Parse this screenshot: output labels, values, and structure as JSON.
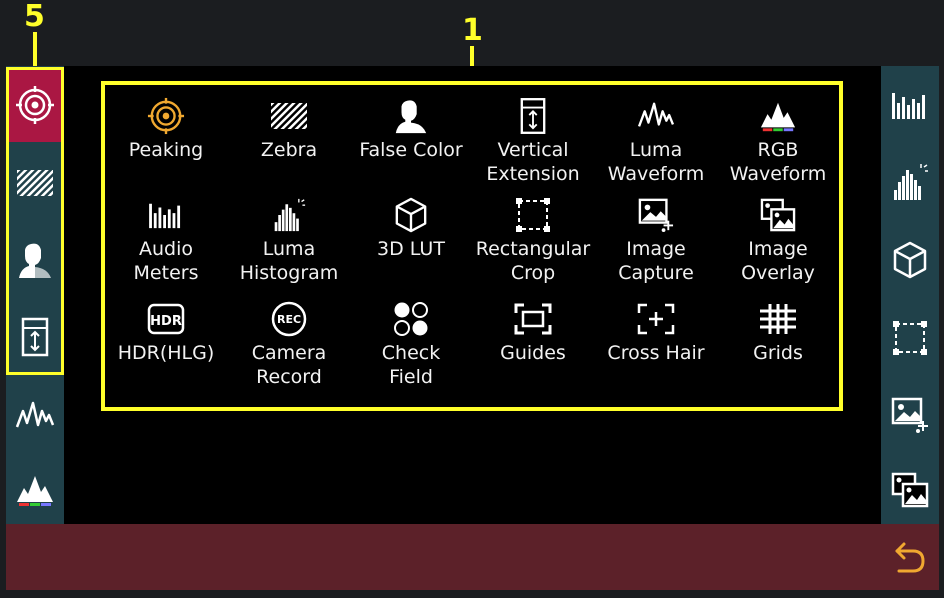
{
  "callouts": {
    "left_number": "5",
    "top_number": "1"
  },
  "colors": {
    "accent": "#ffff2a",
    "active": "#aa1743",
    "sidebar": "#20414a",
    "bottom": "#5c2129",
    "peaking": "#f0a830",
    "return": "#f0a830"
  },
  "left_sidebar": {
    "items": [
      {
        "icon": "peaking-icon",
        "active": true
      },
      {
        "icon": "zebra-icon",
        "active": false
      },
      {
        "icon": "false-color-icon",
        "active": false
      },
      {
        "icon": "vertical-extension-icon",
        "active": false
      },
      {
        "icon": "luma-waveform-icon",
        "active": false
      },
      {
        "icon": "rgb-waveform-icon",
        "active": false
      }
    ]
  },
  "right_sidebar": {
    "items": [
      {
        "icon": "audio-meters-icon"
      },
      {
        "icon": "luma-histogram-icon"
      },
      {
        "icon": "3d-lut-icon"
      },
      {
        "icon": "rectangular-crop-icon"
      },
      {
        "icon": "image-capture-icon"
      },
      {
        "icon": "image-overlay-icon"
      }
    ]
  },
  "tools": [
    {
      "label": "Peaking",
      "icon": "peaking-icon"
    },
    {
      "label": "Zebra",
      "icon": "zebra-icon"
    },
    {
      "label": "False Color",
      "icon": "false-color-icon"
    },
    {
      "label": "Vertical\nExtension",
      "icon": "vertical-extension-icon"
    },
    {
      "label": "Luma\nWaveform",
      "icon": "luma-waveform-icon"
    },
    {
      "label": "RGB\nWaveform",
      "icon": "rgb-waveform-icon"
    },
    {
      "label": "Audio\nMeters",
      "icon": "audio-meters-icon"
    },
    {
      "label": "Luma\nHistogram",
      "icon": "luma-histogram-icon"
    },
    {
      "label": "3D LUT",
      "icon": "3d-lut-icon"
    },
    {
      "label": "Rectangular\nCrop",
      "icon": "rectangular-crop-icon"
    },
    {
      "label": "Image\nCapture",
      "icon": "image-capture-icon"
    },
    {
      "label": "Image\nOverlay",
      "icon": "image-overlay-icon"
    },
    {
      "label": "HDR(HLG)",
      "icon": "hdr-icon",
      "icon_text": "HDR"
    },
    {
      "label": "Camera\nRecord",
      "icon": "camera-record-icon",
      "icon_text": "REC"
    },
    {
      "label": "Check\nField",
      "icon": "check-field-icon"
    },
    {
      "label": "Guides",
      "icon": "guides-icon"
    },
    {
      "label": "Cross Hair",
      "icon": "cross-hair-icon"
    },
    {
      "label": "Grids",
      "icon": "grids-icon"
    }
  ],
  "bottom_bar": {
    "return_icon": "return-icon"
  }
}
